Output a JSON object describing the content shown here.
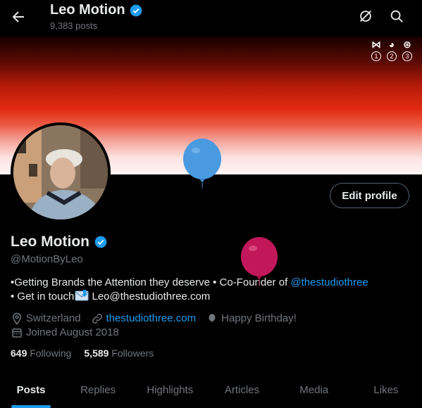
{
  "header": {
    "name": "Leo Motion",
    "posts_count": "9,383 posts",
    "back_icon": "arrow-left-icon",
    "icons": [
      "refresh-slash-icon",
      "search-icon"
    ]
  },
  "banner": {
    "logos": [
      {
        "mark": "⋈",
        "num": "1"
      },
      {
        "mark": "◕",
        "num": "2"
      },
      {
        "mark": "⊛",
        "num": "3"
      }
    ]
  },
  "profile": {
    "name": "Leo Motion",
    "handle": "@MotionByLeo",
    "edit_label": "Edit profile",
    "bio_line1_prefix": "•Getting Brands the Attention they deserve • Co-Founder of ",
    "bio_line1_link": "@thestudiothree",
    "bio_line2_prefix": "• Get in touch",
    "bio_line2_suffix": " Leo@thestudiothree.com",
    "location": "Switzerland",
    "website": "thestudiothree.com",
    "birthday": "Happy Birthday!",
    "joined": "Joined August 2018",
    "following_count": "649",
    "following_label": "Following",
    "followers_count": "5,589",
    "followers_label": "Followers"
  },
  "tabs": [
    "Posts",
    "Replies",
    "Highlights",
    "Articles",
    "Media",
    "Likes"
  ],
  "colors": {
    "accent": "#1d9bf0",
    "verified": "#1d9bf0",
    "balloon_blue": "#4a9ae0",
    "balloon_pink": "#c2185b"
  }
}
